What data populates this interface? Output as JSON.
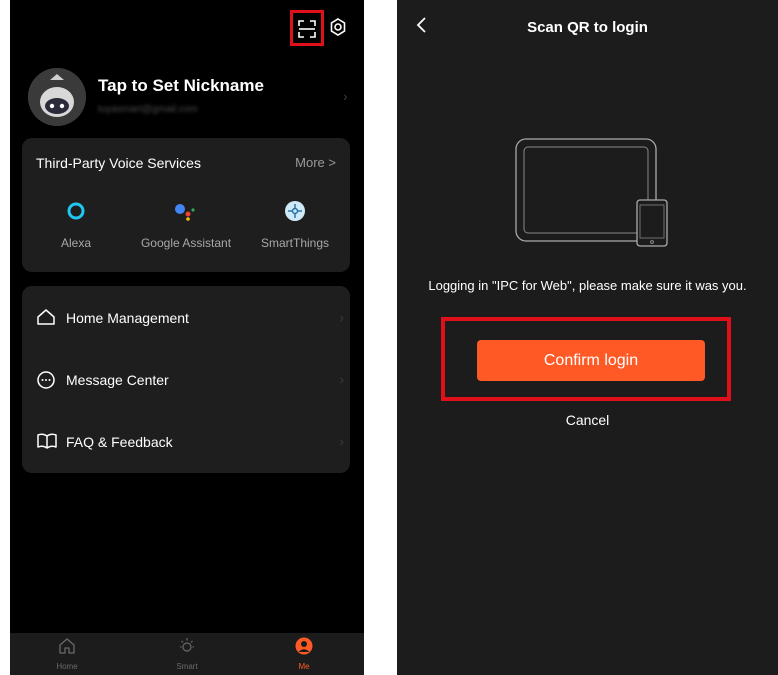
{
  "left": {
    "profile": {
      "nickname": "Tap to Set Nickname",
      "email": "tuyasmart@gmail.com"
    },
    "voice_services": {
      "title": "Third-Party Voice Services",
      "more": "More >",
      "items": [
        {
          "label": "Alexa",
          "icon": "alexa-icon",
          "color": "#1ec8f0"
        },
        {
          "label": "Google Assistant",
          "icon": "google-assistant-icon",
          "color": "#4285f4"
        },
        {
          "label": "SmartThings",
          "icon": "smartthings-icon",
          "color": "#cfe9f7"
        }
      ]
    },
    "menu": [
      {
        "label": "Home Management",
        "icon": "home-icon"
      },
      {
        "label": "Message Center",
        "icon": "message-icon"
      },
      {
        "label": "FAQ & Feedback",
        "icon": "book-icon"
      }
    ],
    "tabs": [
      {
        "label": "Home",
        "icon": "home-tab-icon",
        "active": false
      },
      {
        "label": "Smart",
        "icon": "sun-icon",
        "active": false
      },
      {
        "label": "Me",
        "icon": "person-icon",
        "active": true
      }
    ]
  },
  "right": {
    "title": "Scan QR to login",
    "message": "Logging in \"IPC for Web\", please make sure it was you.",
    "confirm": "Confirm login",
    "cancel": "Cancel"
  },
  "colors": {
    "accent": "#ff5a26",
    "highlight": "#e0101a"
  }
}
